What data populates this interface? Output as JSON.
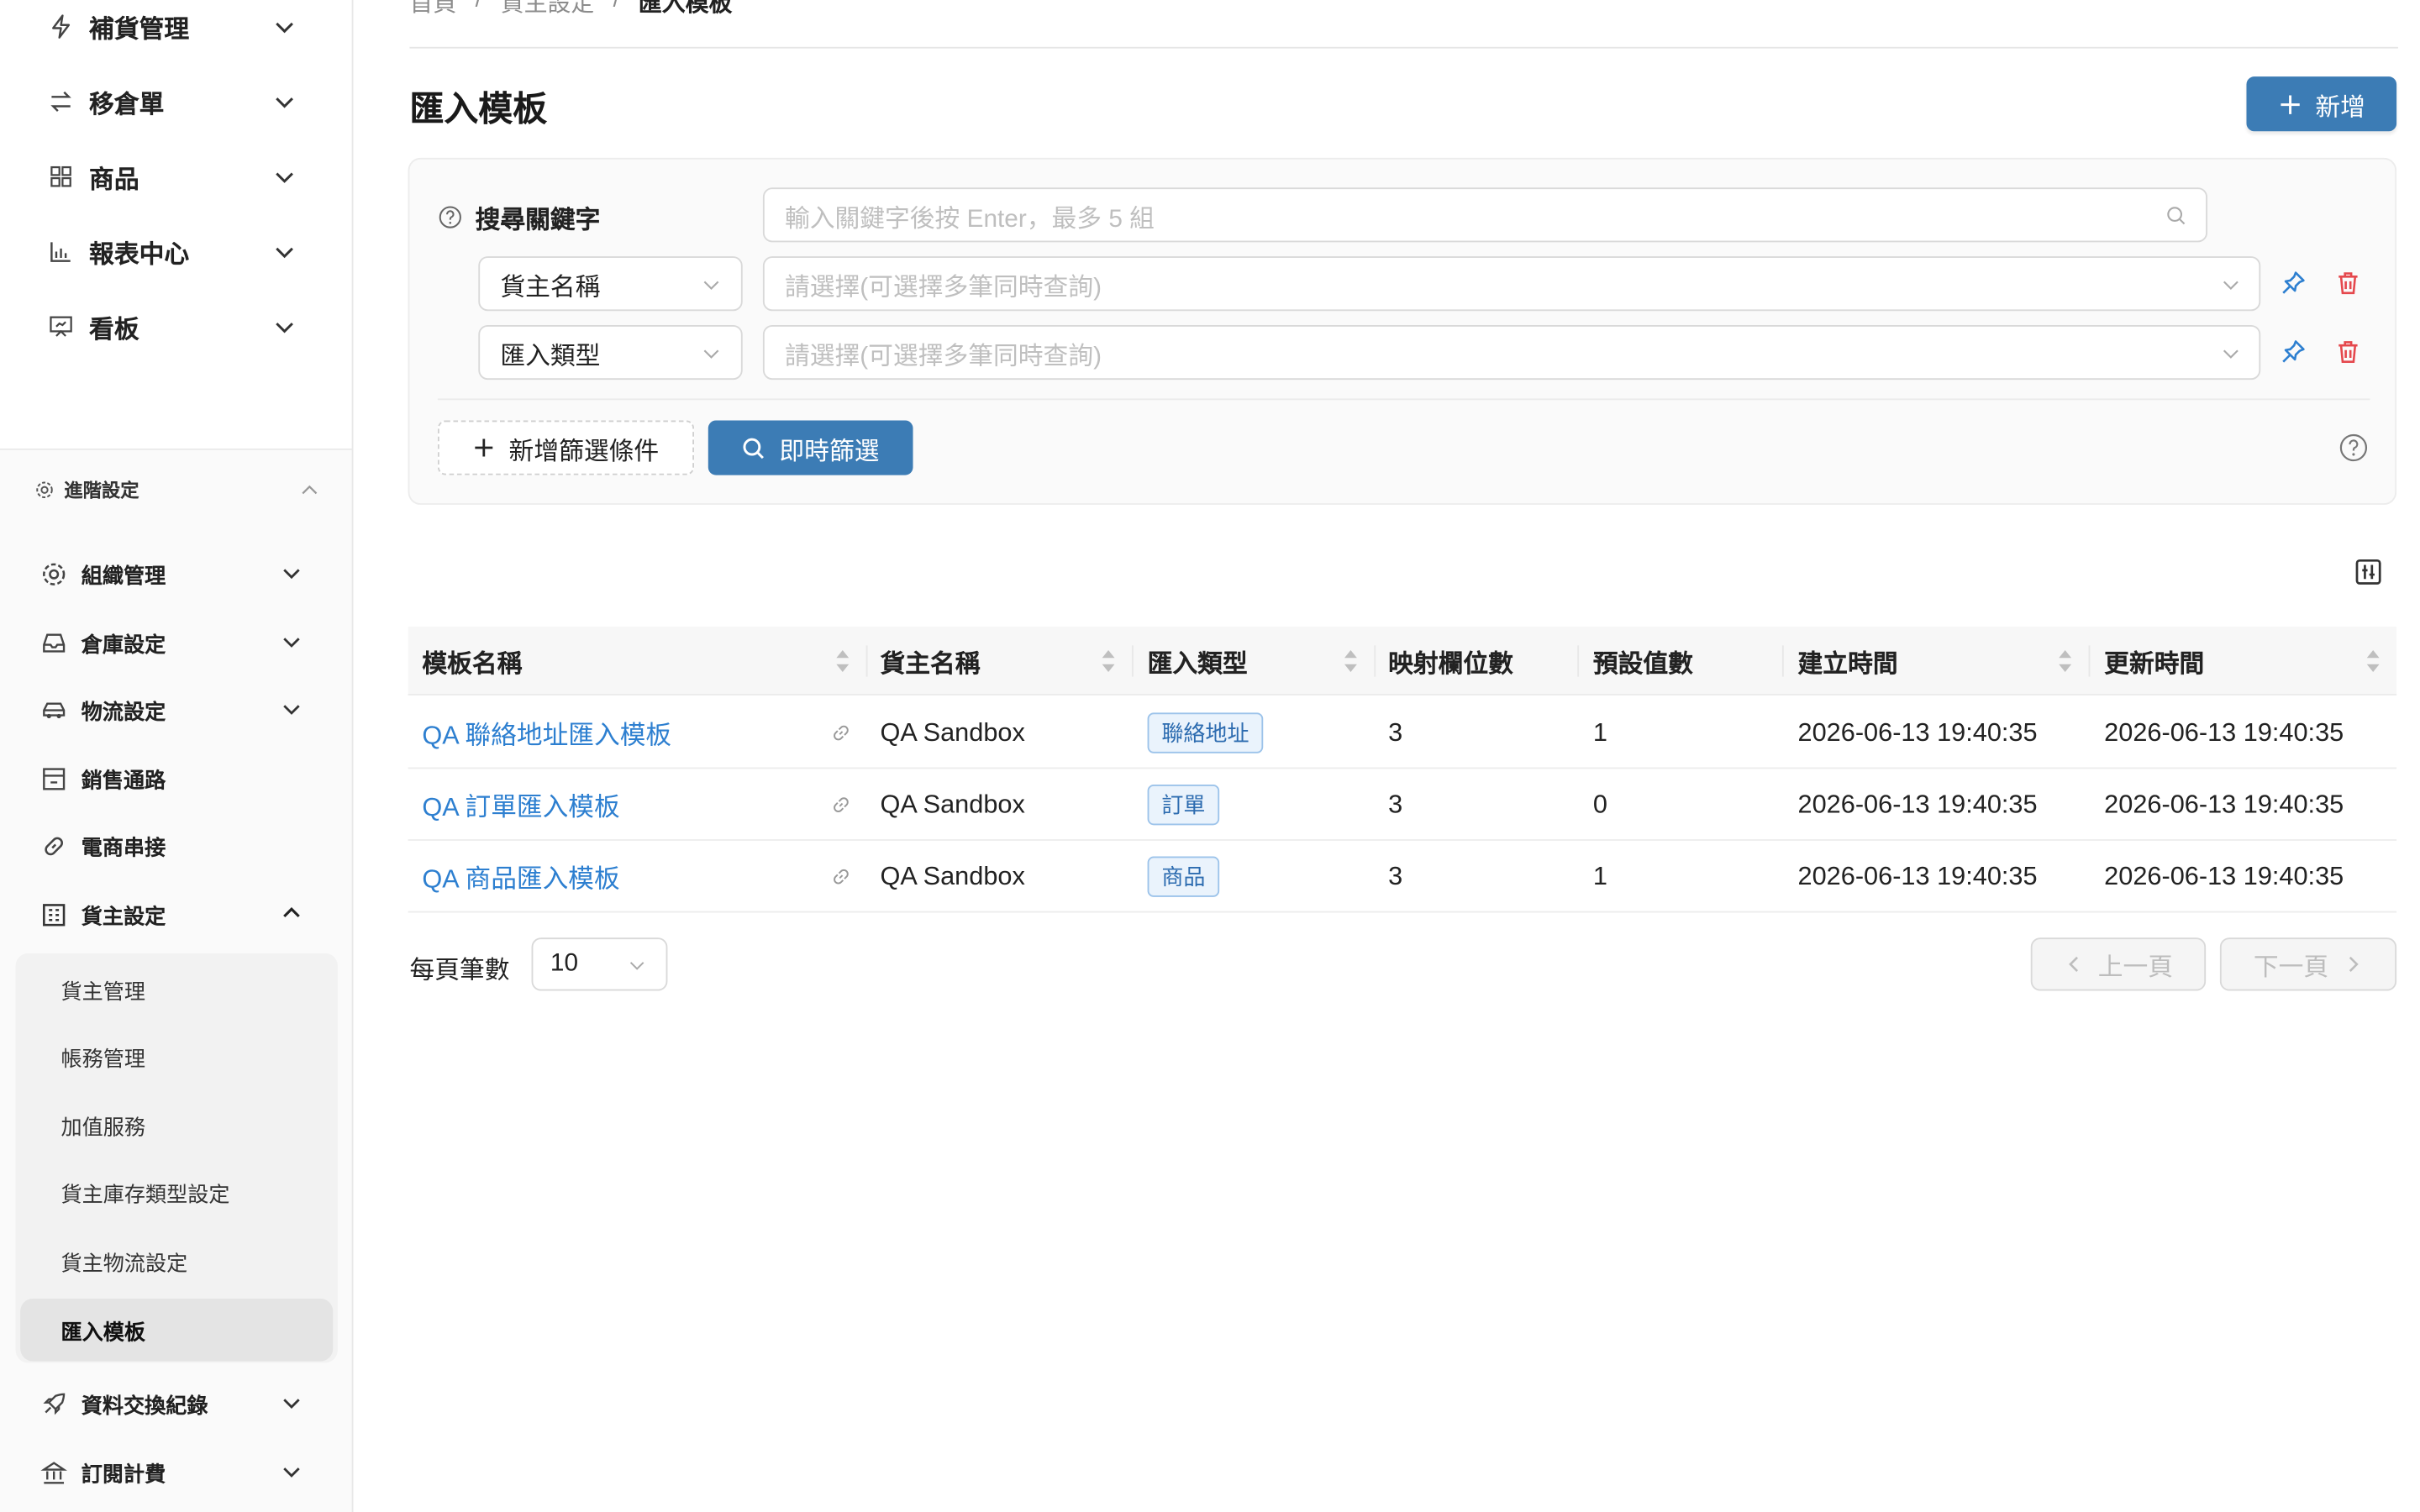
{
  "sidebar": {
    "top_items": [
      {
        "label": "補貨管理",
        "icon": "bolt-icon"
      },
      {
        "label": "移倉單",
        "icon": "transfer-icon"
      },
      {
        "label": "商品",
        "icon": "grid-icon"
      },
      {
        "label": "報表中心",
        "icon": "bar-chart-icon"
      },
      {
        "label": "看板",
        "icon": "board-icon"
      }
    ],
    "advanced_title": "進階設定",
    "groups": [
      {
        "label": "組織管理",
        "icon": "gear-icon"
      },
      {
        "label": "倉庫設定",
        "icon": "inbox-icon"
      },
      {
        "label": "物流設定",
        "icon": "car-icon"
      },
      {
        "label": "銷售通路",
        "icon": "shop-icon"
      },
      {
        "label": "電商串接",
        "icon": "link-icon"
      },
      {
        "label": "貨主設定",
        "icon": "building-icon"
      },
      {
        "label": "資料交換紀錄",
        "icon": "rocket-icon"
      },
      {
        "label": "訂閱計費",
        "icon": "bank-icon"
      }
    ],
    "owner_sub_items": [
      {
        "label": "貨主管理"
      },
      {
        "label": "帳務管理"
      },
      {
        "label": "加值服務"
      },
      {
        "label": "貨主庫存類型設定"
      },
      {
        "label": "貨主物流設定"
      },
      {
        "label": "匯入模板"
      }
    ]
  },
  "breadcrumb": [
    "首頁",
    "/",
    "貨主設定",
    "/",
    "匯入模板"
  ],
  "page": {
    "title": "匯入模板",
    "add_button": "新增"
  },
  "filter": {
    "keyword_label": "搜尋關鍵字",
    "keyword_placeholder": "輸入關鍵字後按 Enter，最多 5 組",
    "conditions": [
      {
        "field": "貨主名稱",
        "placeholder": "請選擇(可選擇多筆同時查詢)"
      },
      {
        "field": "匯入類型",
        "placeholder": "請選擇(可選擇多筆同時查詢)"
      }
    ],
    "add_condition_button": "新增篩選條件",
    "instant_filter_button": "即時篩選"
  },
  "table": {
    "columns": [
      "模板名稱",
      "貨主名稱",
      "匯入類型",
      "映射欄位數",
      "預設值數",
      "建立時間",
      "更新時間"
    ],
    "rows": [
      {
        "name": "QA 聯絡地址匯入模板",
        "owner": "QA Sandbox",
        "type": "聯絡地址",
        "mapped": "3",
        "defaults": "1",
        "created": "2026-06-13 19:40:35",
        "updated": "2026-06-13 19:40:35"
      },
      {
        "name": "QA 訂單匯入模板",
        "owner": "QA Sandbox",
        "type": "訂單",
        "mapped": "3",
        "defaults": "0",
        "created": "2026-06-13 19:40:35",
        "updated": "2026-06-13 19:40:35"
      },
      {
        "name": "QA 商品匯入模板",
        "owner": "QA Sandbox",
        "type": "商品",
        "mapped": "3",
        "defaults": "1",
        "created": "2026-06-13 19:40:35",
        "updated": "2026-06-13 19:40:35"
      }
    ]
  },
  "pagination": {
    "per_page_label": "每頁筆數",
    "per_page_value": "10",
    "prev_label": "上一頁",
    "next_label": "下一頁"
  },
  "colors": {
    "primary": "#3c7cb5",
    "link": "#2d7fd0",
    "danger": "#e5484d",
    "tag_bg": "#eaf3fc",
    "tag_border": "#9cc3ea"
  }
}
